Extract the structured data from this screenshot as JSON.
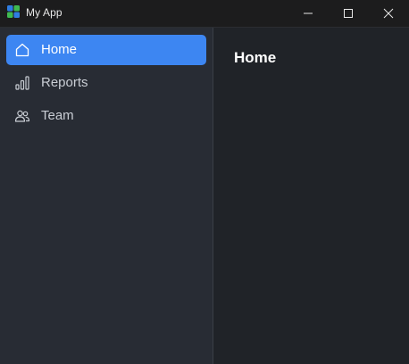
{
  "window": {
    "title": "My App"
  },
  "sidebar": {
    "items": [
      {
        "label": "Home",
        "icon": "home-icon",
        "active": true
      },
      {
        "label": "Reports",
        "icon": "bar-chart-icon",
        "active": false
      },
      {
        "label": "Team",
        "icon": "people-icon",
        "active": false
      }
    ]
  },
  "main": {
    "title": "Home"
  },
  "colors": {
    "accent": "#3d86f2",
    "sidebar_bg": "#282c34",
    "main_bg": "#202328",
    "titlebar_bg": "#1c1c1d"
  }
}
